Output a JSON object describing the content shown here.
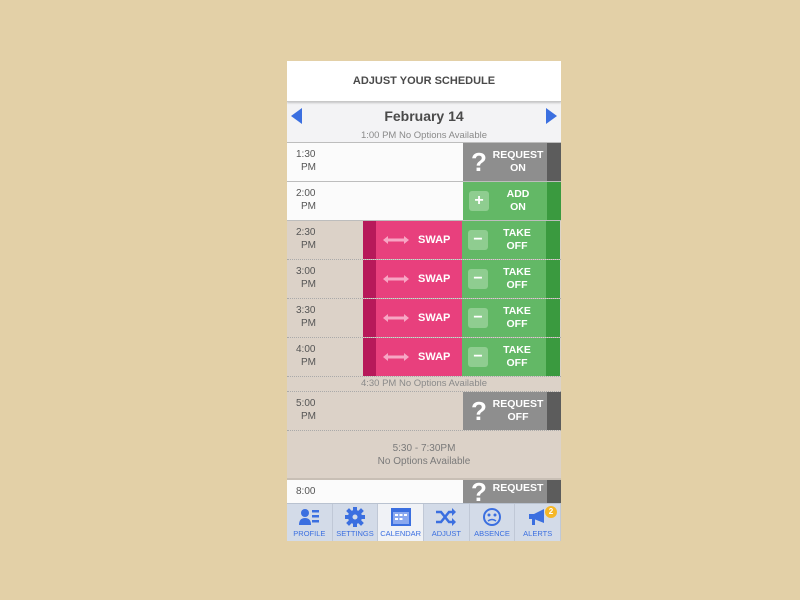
{
  "header": {
    "title": "ADJUST YOUR SCHEDULE"
  },
  "datebar": {
    "date": "February 14",
    "prev_icon": "triangle-left",
    "next_icon": "triangle-right"
  },
  "notes": {
    "n1": "1:00 PM  No Options Available",
    "n2": "4:30 PM  No Options Available",
    "gap_time": "5:30 - 7:30PM",
    "gap_text": "No Options Available"
  },
  "rows": [
    {
      "time": "1:30",
      "ampm": "PM",
      "action": "REQUEST",
      "action2": "ON",
      "icon": "?"
    },
    {
      "time": "2:00",
      "ampm": "PM",
      "action": "ADD",
      "action2": "ON",
      "icon": "+"
    },
    {
      "time": "2:30",
      "ampm": "PM",
      "swap": "SWAP",
      "action": "TAKE",
      "action2": "OFF",
      "icon": "−"
    },
    {
      "time": "3:00",
      "ampm": "PM",
      "swap": "SWAP",
      "action": "TAKE",
      "action2": "OFF",
      "icon": "−"
    },
    {
      "time": "3:30",
      "ampm": "PM",
      "swap": "SWAP",
      "action": "TAKE",
      "action2": "OFF",
      "icon": "−"
    },
    {
      "time": "4:00",
      "ampm": "PM",
      "swap": "SWAP",
      "action": "TAKE",
      "action2": "OFF",
      "icon": "−"
    },
    {
      "time": "5:00",
      "ampm": "PM",
      "action": "REQUEST",
      "action2": "OFF",
      "icon": "?"
    },
    {
      "time": "8:00",
      "ampm": "",
      "action": "REQUEST",
      "action2": "",
      "icon": "?"
    }
  ],
  "tabs": [
    {
      "label": "PROFILE"
    },
    {
      "label": "SETTINGS"
    },
    {
      "label": "CALENDAR"
    },
    {
      "label": "ADJUST"
    },
    {
      "label": "ABSENCE"
    },
    {
      "label": "ALERTS",
      "badge": "2"
    }
  ],
  "colors": {
    "accent": "#3b6fe0",
    "swap": "#e8407d",
    "green": "#63b866",
    "gray": "#8e8e8e",
    "badge": "#f5b728"
  }
}
